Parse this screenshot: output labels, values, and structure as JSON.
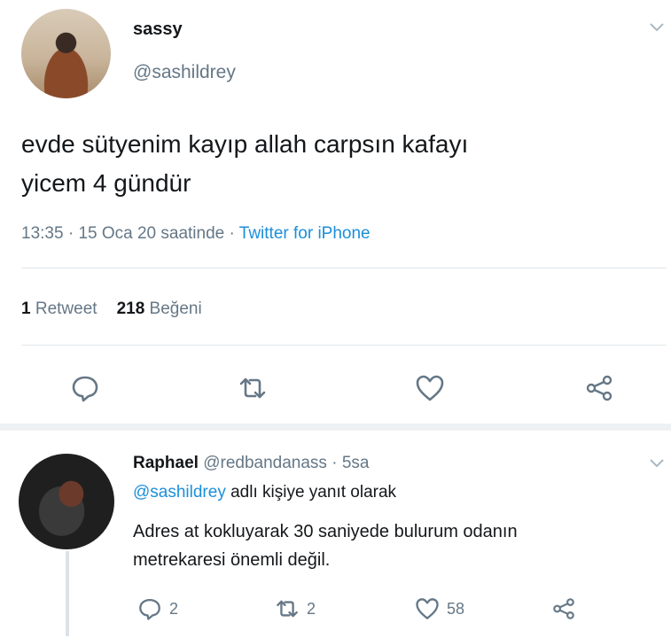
{
  "tweet": {
    "author_name": "sassy",
    "author_handle": "@sashildrey",
    "text_line1": "evde sütyenim kayıp allah carpsın kafayı",
    "text_line2": "yicem 4 gündür",
    "time": "13:35",
    "date": "15 Oca 20 saatinde",
    "source": "Twitter for iPhone",
    "retweet_count": "1",
    "retweet_label": "Retweet",
    "like_count": "218",
    "like_label": "Beğeni"
  },
  "reply": {
    "author_name": "Raphael",
    "author_handle": "@redbandanass",
    "age": "5sa",
    "reply_to_mention": "@sashildrey",
    "reply_to_suffix": "adlı kişiye yanıt olarak",
    "text_line1": "Adres at kokluyarak 30 saniyede bulurum odanın",
    "text_line2": "metrekaresi önemli değil.",
    "reply_count": "2",
    "retweet_count": "2",
    "like_count": "58"
  },
  "icons": {
    "reply": "reply-icon",
    "retweet": "retweet-icon",
    "like": "heart-icon",
    "share": "share-icon",
    "menu": "chevron-down-icon"
  },
  "colors": {
    "text": "#14171a",
    "secondary": "#657786",
    "link": "#1b8fd9",
    "divider": "#e1e8ed"
  }
}
